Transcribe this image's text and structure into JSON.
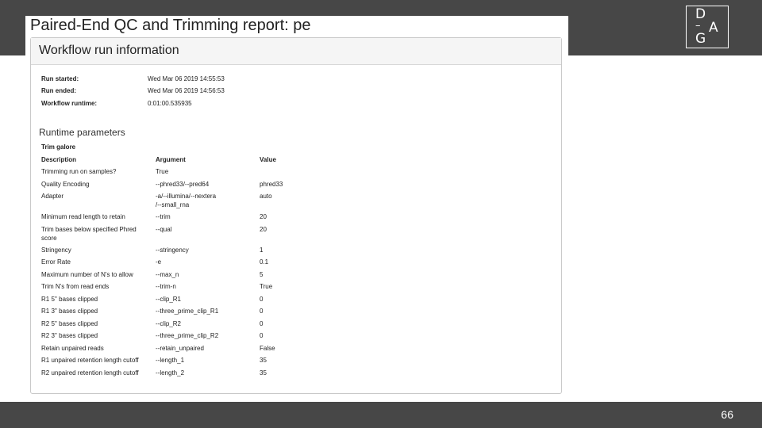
{
  "slide": {
    "page_number": "66",
    "logo": {
      "letters": [
        "D",
        "A",
        "G"
      ]
    }
  },
  "report": {
    "title": "Paired-End QC and Trimming report: pe",
    "panel_title": "Workflow run information",
    "run_info": [
      {
        "label": "Run started:",
        "value": "Wed Mar 06 2019 14:55:53"
      },
      {
        "label": "Run ended:",
        "value": "Wed Mar 06 2019 14:56:53"
      },
      {
        "label": "Workflow runtime:",
        "value": "0:01:00.535935"
      }
    ],
    "runtime_parameters": {
      "heading": "Runtime parameters",
      "group": "Trim galore",
      "columns": [
        "Description",
        "Argument",
        "Value"
      ],
      "rows": [
        {
          "description": "Trimming run on samples?",
          "argument": "True",
          "value": ""
        },
        {
          "description": "Quality Encoding",
          "argument": "--phred33/--pred64",
          "value": "phred33"
        },
        {
          "description": "Adapter",
          "argument": "-a/--illumina/--nextera",
          "argument_line2": "/--small_rna",
          "value": "auto"
        },
        {
          "description": "Minimum read length to retain",
          "argument": "--trim",
          "value": "20"
        },
        {
          "description": "Trim bases below specified Phred",
          "description_line2": "score",
          "argument": "--qual",
          "value": "20"
        },
        {
          "description": "Stringency",
          "argument": "--stringency",
          "value": "1"
        },
        {
          "description": "Error Rate",
          "argument": "-e",
          "value": "0.1"
        },
        {
          "description": "Maximum number of N's to allow",
          "argument": "--max_n",
          "value": "5"
        },
        {
          "description": "Trim N's from read ends",
          "argument": "--trim-n",
          "value": "True"
        },
        {
          "description": "R1 5'' bases clipped",
          "argument": "--clip_R1",
          "value": "0"
        },
        {
          "description": "R1 3'' bases clipped",
          "argument": "--three_prime_clip_R1",
          "value": "0"
        },
        {
          "description": "R2 5'' bases clipped",
          "argument": "--clip_R2",
          "value": "0"
        },
        {
          "description": "R2 3'' bases clipped",
          "argument": "--three_prime_clip_R2",
          "value": "0"
        },
        {
          "description": "Retain unpaired reads",
          "argument": "--retain_unpaired",
          "value": "False"
        },
        {
          "description": "R1 unpaired retention length cutoff",
          "argument": "--length_1",
          "value": "35"
        },
        {
          "description": "R2 unpaired retention length cutoff",
          "argument": "--length_2",
          "value": "35"
        }
      ]
    }
  }
}
